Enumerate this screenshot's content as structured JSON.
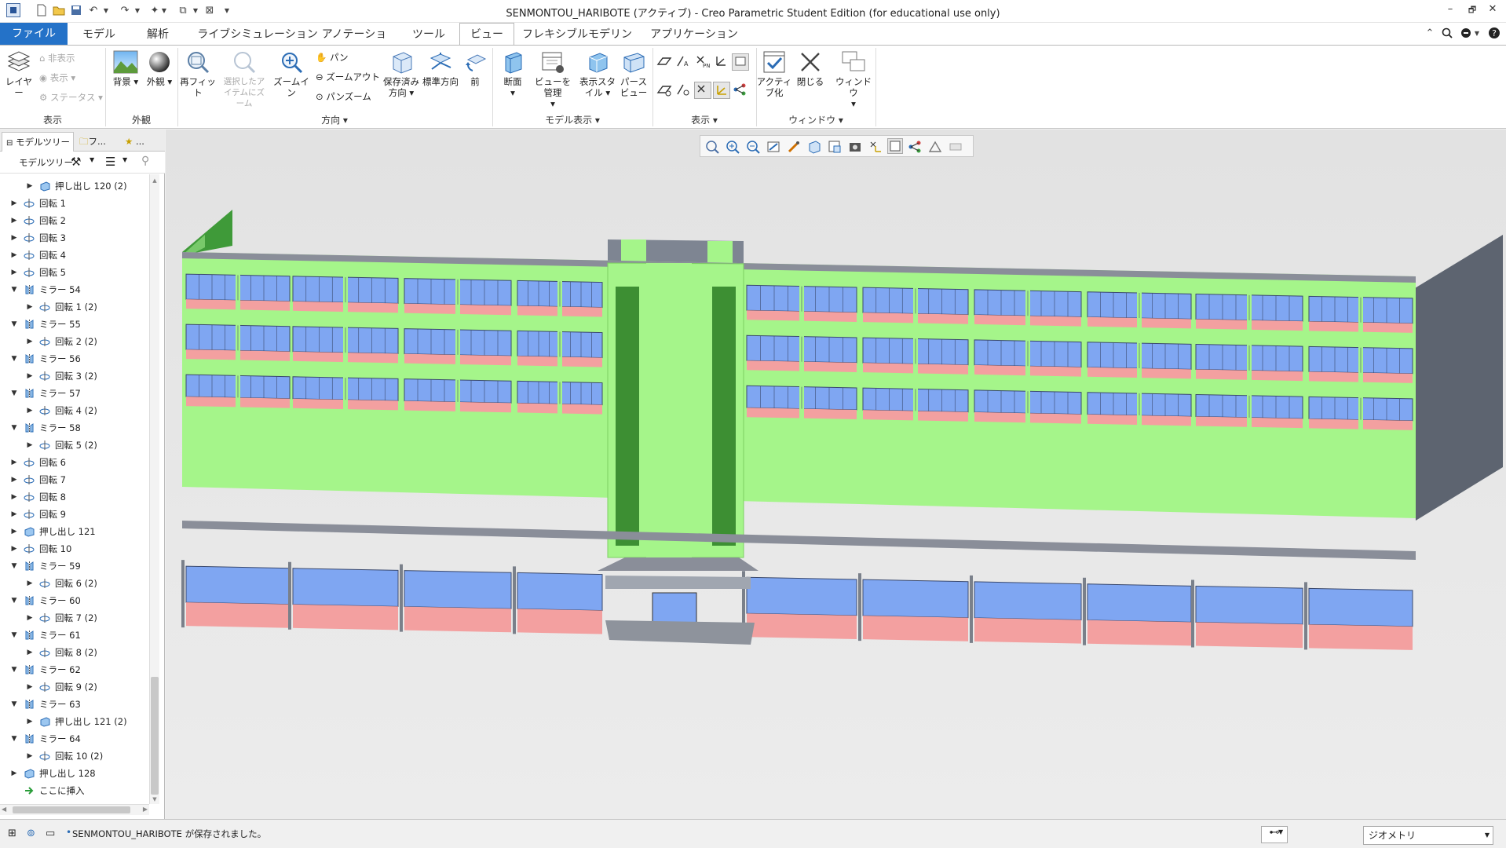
{
  "window": {
    "title": "SENMONTOU_HARIBOTE (アクティブ) - Creo Parametric Student Edition (for educational use only)",
    "minimize": "–",
    "restore": "🗗",
    "close": "✕"
  },
  "tabs": [
    "ファイル",
    "モデル",
    "解析",
    "ライブシミュレーション",
    "アノテーション",
    "ツール",
    "ビュー",
    "フレキシブルモデリング",
    "アプリケーション"
  ],
  "active_tab": "ビュー",
  "ribbon": {
    "show_group": {
      "label": "表示",
      "layer": "レイヤー",
      "hide": "非表示",
      "show": "表示",
      "status": "ステータス"
    },
    "appearance_group": {
      "label": "外観",
      "bg": "背景",
      "appearance": "外観"
    },
    "orientation_group": {
      "label": "方向",
      "refit": "再フィット",
      "zoom_selected": "選択したアイテムにズーム",
      "zoom_in": "ズームイン",
      "pan": "パン",
      "zoom_out": "ズームアウト",
      "pan_zoom": "パンズーム",
      "saved_orient": "保存済み方向",
      "standard_orient": "標準方向",
      "previous": "前"
    },
    "model_display_group": {
      "label": "モデル表示",
      "section": "断面",
      "manage_views": "ビューを管理",
      "display_style": "表示スタイル",
      "perspective": "パースビュー"
    },
    "display_group": {
      "label": "表示"
    },
    "window_group": {
      "label": "ウィンドウ",
      "activate": "アクティブ化",
      "close": "閉じる",
      "windows": "ウィンドウ"
    }
  },
  "left_panel": {
    "tab_model_tree": "モデルツリー",
    "tab_folder": "フ...",
    "tab_fav": "...",
    "tree_label": "モデルツリー",
    "rows": [
      {
        "indent": 1,
        "expand": "▶",
        "icon": "extrude",
        "label": "押し出し 120 (2)"
      },
      {
        "indent": 0,
        "expand": "▶",
        "icon": "revolve",
        "label": "回転 1"
      },
      {
        "indent": 0,
        "expand": "▶",
        "icon": "revolve",
        "label": "回転 2"
      },
      {
        "indent": 0,
        "expand": "▶",
        "icon": "revolve",
        "label": "回転 3"
      },
      {
        "indent": 0,
        "expand": "▶",
        "icon": "revolve",
        "label": "回転 4"
      },
      {
        "indent": 0,
        "expand": "▶",
        "icon": "revolve",
        "label": "回転 5"
      },
      {
        "indent": 0,
        "expand": "▼",
        "icon": "mirror",
        "label": "ミラー 54"
      },
      {
        "indent": 1,
        "expand": "▶",
        "icon": "revolve",
        "label": "回転 1 (2)"
      },
      {
        "indent": 0,
        "expand": "▼",
        "icon": "mirror",
        "label": "ミラー 55"
      },
      {
        "indent": 1,
        "expand": "▶",
        "icon": "revolve",
        "label": "回転 2 (2)"
      },
      {
        "indent": 0,
        "expand": "▼",
        "icon": "mirror",
        "label": "ミラー 56"
      },
      {
        "indent": 1,
        "expand": "▶",
        "icon": "revolve",
        "label": "回転 3 (2)"
      },
      {
        "indent": 0,
        "expand": "▼",
        "icon": "mirror",
        "label": "ミラー 57"
      },
      {
        "indent": 1,
        "expand": "▶",
        "icon": "revolve",
        "label": "回転 4 (2)"
      },
      {
        "indent": 0,
        "expand": "▼",
        "icon": "mirror",
        "label": "ミラー 58"
      },
      {
        "indent": 1,
        "expand": "▶",
        "icon": "revolve",
        "label": "回転 5 (2)"
      },
      {
        "indent": 0,
        "expand": "▶",
        "icon": "revolve",
        "label": "回転 6"
      },
      {
        "indent": 0,
        "expand": "▶",
        "icon": "revolve",
        "label": "回転 7"
      },
      {
        "indent": 0,
        "expand": "▶",
        "icon": "revolve",
        "label": "回転 8"
      },
      {
        "indent": 0,
        "expand": "▶",
        "icon": "revolve",
        "label": "回転 9"
      },
      {
        "indent": 0,
        "expand": "▶",
        "icon": "extrude",
        "label": "押し出し 121"
      },
      {
        "indent": 0,
        "expand": "▶",
        "icon": "revolve",
        "label": "回転 10"
      },
      {
        "indent": 0,
        "expand": "▼",
        "icon": "mirror",
        "label": "ミラー 59"
      },
      {
        "indent": 1,
        "expand": "▶",
        "icon": "revolve",
        "label": "回転 6 (2)"
      },
      {
        "indent": 0,
        "expand": "▼",
        "icon": "mirror",
        "label": "ミラー 60"
      },
      {
        "indent": 1,
        "expand": "▶",
        "icon": "revolve",
        "label": "回転 7 (2)"
      },
      {
        "indent": 0,
        "expand": "▼",
        "icon": "mirror",
        "label": "ミラー 61"
      },
      {
        "indent": 1,
        "expand": "▶",
        "icon": "revolve",
        "label": "回転 8 (2)"
      },
      {
        "indent": 0,
        "expand": "▼",
        "icon": "mirror",
        "label": "ミラー 62"
      },
      {
        "indent": 1,
        "expand": "▶",
        "icon": "revolve",
        "label": "回転 9 (2)"
      },
      {
        "indent": 0,
        "expand": "▼",
        "icon": "mirror",
        "label": "ミラー 63"
      },
      {
        "indent": 1,
        "expand": "▶",
        "icon": "extrude",
        "label": "押し出し 121 (2)"
      },
      {
        "indent": 0,
        "expand": "▼",
        "icon": "mirror",
        "label": "ミラー 64"
      },
      {
        "indent": 1,
        "expand": "▶",
        "icon": "revolve",
        "label": "回転 10 (2)"
      },
      {
        "indent": 0,
        "expand": "▶",
        "icon": "extrude",
        "label": "押し出し 128"
      },
      {
        "indent": 0,
        "expand": "",
        "icon": "insert",
        "label": "ここに挿入"
      }
    ]
  },
  "status": {
    "message": "SENMONTOU_HARIBOTE が保存されました。",
    "filter": "ジオメトリ"
  },
  "colors": {
    "wall_green": "#a5f58a",
    "window_blue": "#7fa6f2",
    "band_pink": "#f3a0a0",
    "roof_gray": "#8a8e99",
    "accent_blue": "#2472c8"
  }
}
